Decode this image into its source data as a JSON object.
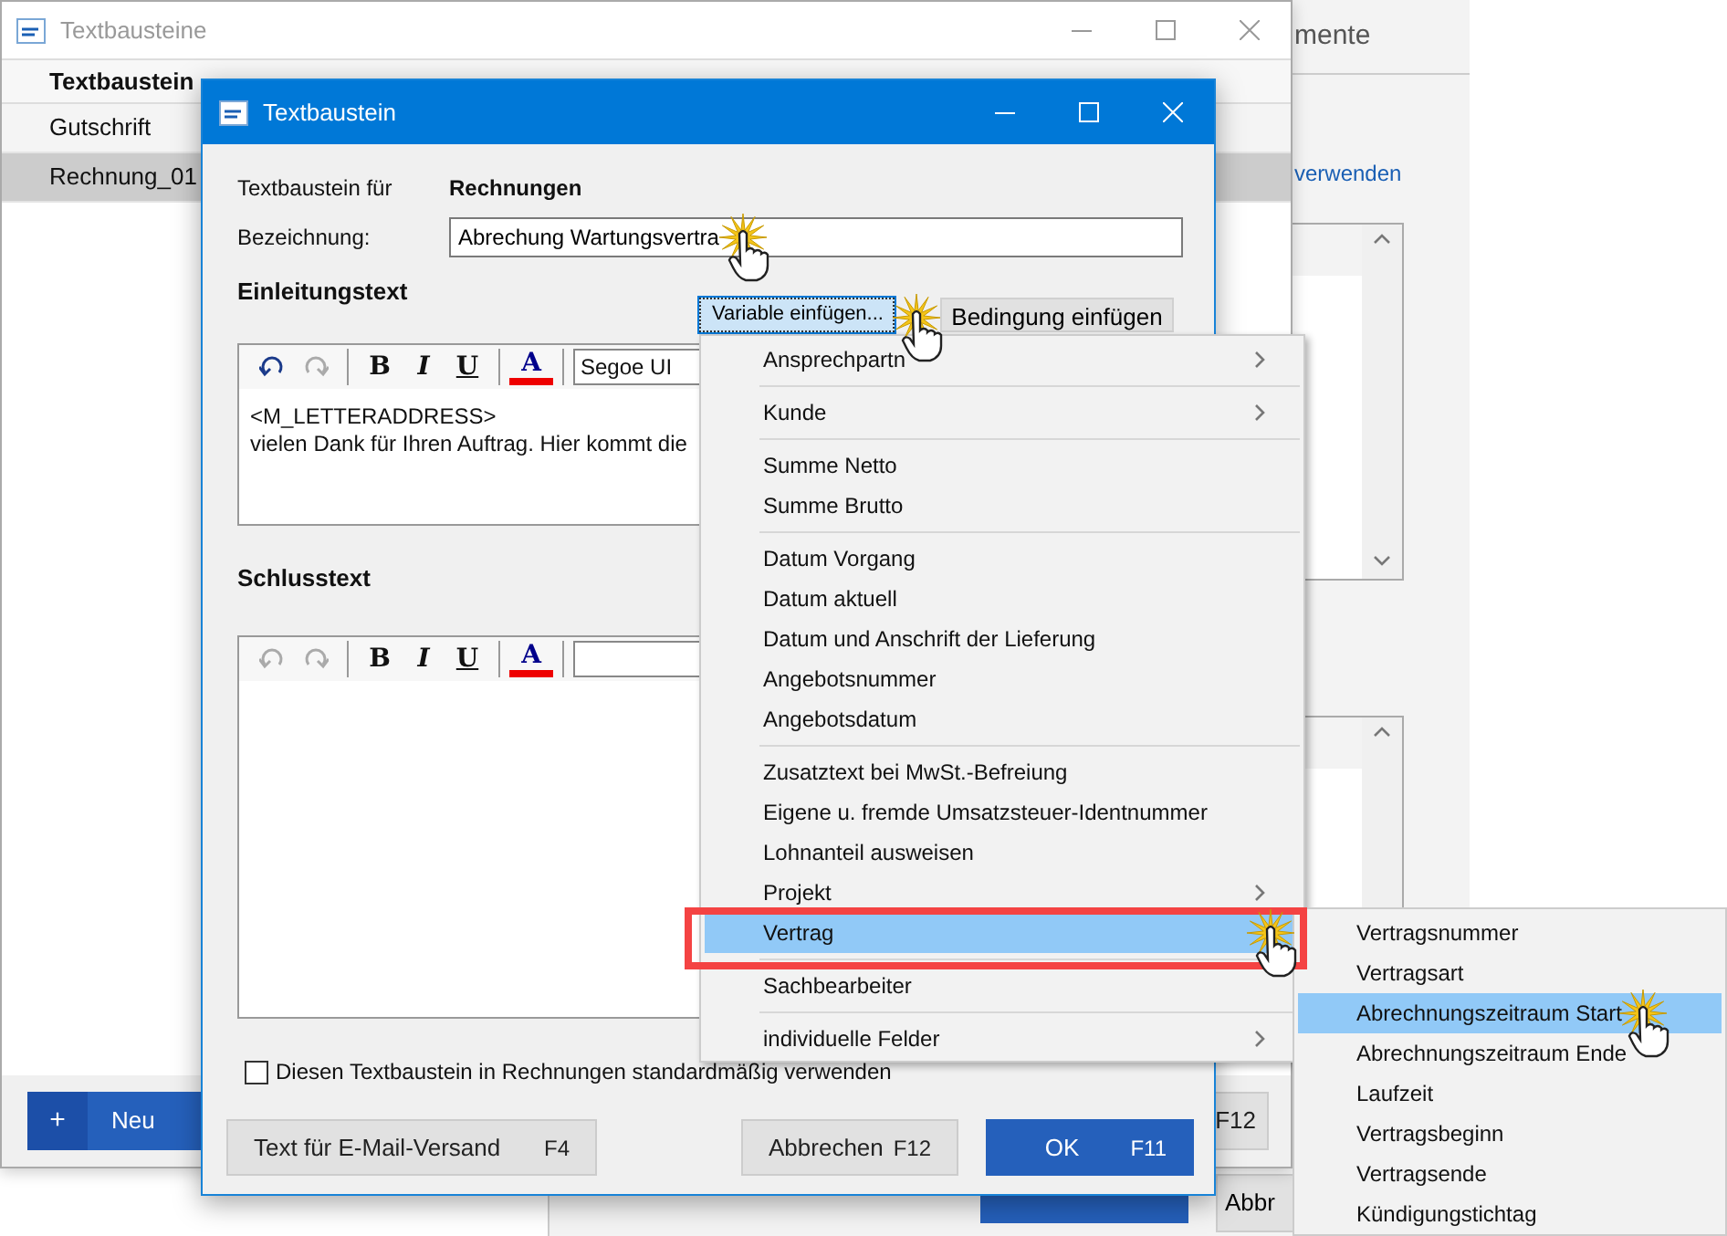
{
  "rear_window": {
    "title": "mente",
    "link": "verwenden",
    "footer_buttons": [
      {
        "kind": "primary"
      },
      {
        "kind": "default",
        "label": "Abbr"
      }
    ]
  },
  "list_window": {
    "title": "Textbausteine",
    "column_header": "Textbaustein",
    "rows": [
      {
        "label": "Gutschrift",
        "selected": false
      },
      {
        "label": "Rechnung_01",
        "selected": true
      }
    ],
    "new_button": {
      "icon": "+",
      "label": "Neu"
    },
    "footer_button": {
      "label": "F12"
    }
  },
  "dialog": {
    "title": "Textbaustein",
    "for_label": "Textbaustein für",
    "for_value": "Rechnungen",
    "name_label": "Bezeichnung:",
    "name_value": "Abrechung Wartungsvertra",
    "insert_variable": "Variable einfügen...",
    "insert_condition": "Bedingung einfügen",
    "editors": [
      {
        "heading": "Einleitungstext",
        "undo_disabled": false,
        "redo_disabled": true,
        "font": "Segoe UI",
        "format_buttons": [
          {
            "kind": "bold",
            "label": "B"
          },
          {
            "kind": "italic",
            "label": "I"
          },
          {
            "kind": "underline",
            "label": "U"
          },
          {
            "kind": "color",
            "label": "A"
          }
        ],
        "lines": [
          "<M_LETTERADDRESS>",
          "vielen Dank für Ihren Auftrag. Hier kommt die"
        ]
      },
      {
        "heading": "Schlusstext",
        "undo_disabled": true,
        "redo_disabled": true,
        "format_buttons": [
          {
            "kind": "bold",
            "label": "B"
          },
          {
            "kind": "italic",
            "label": "I"
          },
          {
            "kind": "underline",
            "label": "U"
          },
          {
            "kind": "color",
            "label": "A"
          }
        ]
      }
    ],
    "default_checkbox": {
      "label": "Diesen Textbaustein in Rechnungen standardmäßig verwenden",
      "checked": false
    },
    "buttons": [
      {
        "kind": "default",
        "label": "Text für E-Mail-Versand",
        "shortcut": "F4"
      },
      {
        "kind": "default",
        "label": "Abbrechen",
        "shortcut": "F12"
      },
      {
        "kind": "primary",
        "label": "OK",
        "shortcut": "F11"
      }
    ]
  },
  "menu": {
    "items": [
      {
        "kind": "item",
        "label": "Ansprechpartn",
        "submenu": true,
        "selected": false
      },
      {
        "kind": "separator"
      },
      {
        "kind": "item",
        "label": "Kunde",
        "submenu": true,
        "selected": false
      },
      {
        "kind": "separator"
      },
      {
        "kind": "item",
        "label": "Summe Netto",
        "selected": false
      },
      {
        "kind": "item",
        "label": "Summe Brutto",
        "selected": false
      },
      {
        "kind": "separator"
      },
      {
        "kind": "item",
        "label": "Datum Vorgang",
        "selected": false
      },
      {
        "kind": "item",
        "label": "Datum aktuell",
        "selected": false
      },
      {
        "kind": "item",
        "label": "Datum und Anschrift der Lieferung",
        "selected": false
      },
      {
        "kind": "item",
        "label": "Angebotsnummer",
        "selected": false
      },
      {
        "kind": "item",
        "label": "Angebotsdatum",
        "selected": false
      },
      {
        "kind": "separator"
      },
      {
        "kind": "item",
        "label": "Zusatztext bei MwSt.-Befreiung",
        "selected": false
      },
      {
        "kind": "item",
        "label": "Eigene u. fremde Umsatzsteuer-Identnummer",
        "selected": false
      },
      {
        "kind": "item",
        "label": "Lohnanteil ausweisen",
        "selected": false
      },
      {
        "kind": "item",
        "label": "Projekt",
        "submenu": true,
        "selected": false
      },
      {
        "kind": "item",
        "label": "Vertrag",
        "selected": true
      },
      {
        "kind": "separator"
      },
      {
        "kind": "item",
        "label": "Sachbearbeiter",
        "selected": false
      },
      {
        "kind": "separator"
      },
      {
        "kind": "item",
        "label": "individuelle Felder",
        "submenu": true,
        "selected": false
      }
    ]
  },
  "submenu": {
    "items": [
      {
        "label": "Vertragsnummer",
        "selected": false
      },
      {
        "label": "Vertragsart",
        "selected": false
      },
      {
        "label": "Abrechnungszeitraum Start",
        "selected": true
      },
      {
        "label": "Abrechnungszeitraum Ende",
        "selected": false
      },
      {
        "label": "Laufzeit",
        "selected": false
      },
      {
        "label": "Vertragsbeginn",
        "selected": false
      },
      {
        "label": "Vertragsende",
        "selected": false
      },
      {
        "label": "Kündigungstichtag",
        "selected": false
      }
    ]
  }
}
